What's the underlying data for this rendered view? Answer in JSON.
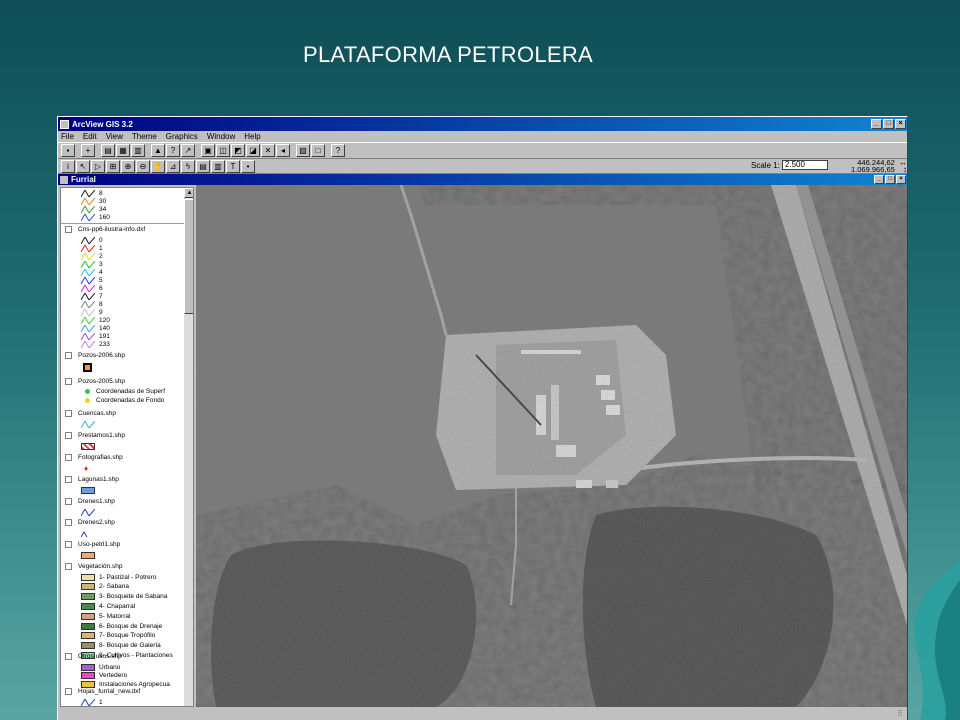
{
  "slide": {
    "title": "PLATAFORMA PETROLERA"
  },
  "app": {
    "title": "ArcView GIS 3.2",
    "menus": [
      "File",
      "Edit",
      "View",
      "Theme",
      "Graphics",
      "Window",
      "Help"
    ],
    "scale_label": "Scale 1:",
    "scale_value": "2.500",
    "coord_x": "446.244,62",
    "coord_y": "1.069.966,65",
    "window_buttons": [
      "_",
      "□",
      "×"
    ]
  },
  "view": {
    "title": "Furrial",
    "themes": [
      {
        "name": "Cns-pp6-ilustra-info.dxf"
      },
      {
        "name": "Pozos-2006.shp"
      },
      {
        "name": "Pozos-2005.shp"
      },
      {
        "name": "Cuencas.shp"
      },
      {
        "name": "Prestamos1.shp"
      },
      {
        "name": "Fotografias.shp"
      },
      {
        "name": "Lagunas1.shp"
      },
      {
        "name": "Drenes1.shp"
      },
      {
        "name": "Drenes2.shp"
      },
      {
        "name": "Uso-petrl1.shp"
      },
      {
        "name": "Vegetación.shp"
      },
      {
        "name": "Otros usos.shp"
      },
      {
        "name": "Hojas_furrial_new.dxf"
      }
    ],
    "top_legend": [
      "8",
      "30",
      "34",
      "160"
    ],
    "dxf_legend": [
      "0",
      "1",
      "2",
      "3",
      "4",
      "5",
      "6",
      "7",
      "8",
      "9",
      "120",
      "140",
      "191",
      "233"
    ],
    "pozos2005_legend": [
      "Coordenadas de Superf",
      "Coordenadas de Fondo"
    ],
    "vegetacion_legend": [
      "1- Pastizal - Potrero",
      "2- Sabana",
      "3- Bosquete de Sabana",
      "4- Chaparral",
      "5- Matorral",
      "6- Bosque de Drenaje",
      "7- Bosque Tropófilo",
      "8- Bosque de Galería",
      "9- Cultivos - Plantaciones"
    ],
    "otros_legend": [
      "Urbano",
      "Vertedero",
      "Instalaciones Agropecua"
    ],
    "hojas_legend": [
      "1"
    ]
  },
  "colors": {
    "top_legend": [
      "#1a1a1a",
      "#e08020",
      "#30a030",
      "#3050e0"
    ],
    "dxf_legend": [
      "#1a1a1a",
      "#e02020",
      "#e0e020",
      "#20c020",
      "#20c0e0",
      "#2040e0",
      "#e020e0",
      "#1a1a1a",
      "#808080",
      "#c0c0c0",
      "#40d040",
      "#40a0f0",
      "#a050e0",
      "#c080e0"
    ],
    "vegetacion": [
      "#e6e69a",
      "#c8b878",
      "#6aa05a",
      "#4a8a4a",
      "#d0a080",
      "#3a7a3a",
      "#d0c060",
      "#909060",
      "#90d0b0"
    ],
    "otros": [
      "#a060e0",
      "#ff40c0",
      "#f0c040"
    ]
  }
}
